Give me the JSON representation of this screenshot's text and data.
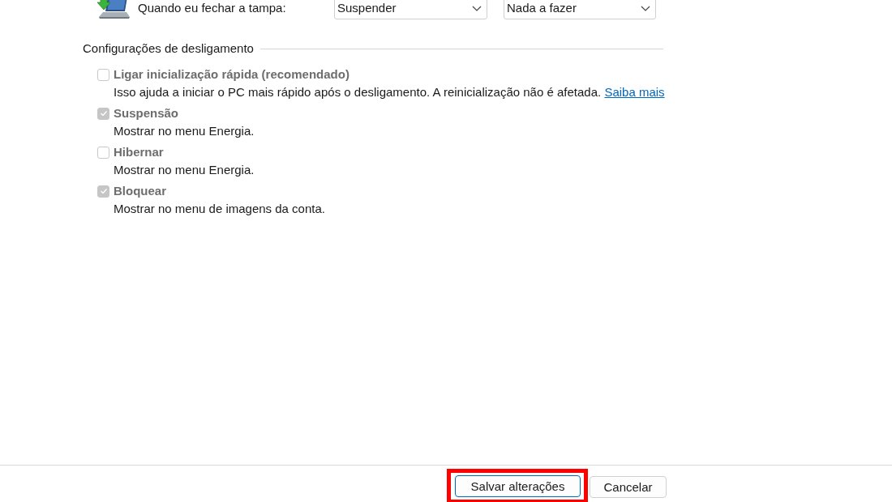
{
  "lid_row": {
    "label": "Quando eu fechar a tampa:",
    "dropdowns": [
      {
        "value": "Suspender"
      },
      {
        "value": "Nada a fazer"
      }
    ]
  },
  "shutdown_settings": {
    "title": "Configurações de desligamento",
    "options": [
      {
        "label": "Ligar inicialização rápida (recomendado)",
        "description": "Isso ajuda a iniciar o PC mais rápido após o desligamento. A reinicialização não é afetada.",
        "link": "Saiba mais",
        "checked": false,
        "disabled": true
      },
      {
        "label": "Suspensão",
        "description": "Mostrar no menu Energia.",
        "checked": true,
        "disabled": true
      },
      {
        "label": "Hibernar",
        "description": "Mostrar no menu Energia.",
        "checked": false,
        "disabled": true
      },
      {
        "label": "Bloquear",
        "description": "Mostrar no menu de imagens da conta.",
        "checked": true,
        "disabled": true
      }
    ]
  },
  "buttons": [
    {
      "label": "Salvar alterações",
      "focused": true,
      "highlighted": true
    },
    {
      "label": "Cancelar",
      "focused": false,
      "highlighted": false
    }
  ]
}
